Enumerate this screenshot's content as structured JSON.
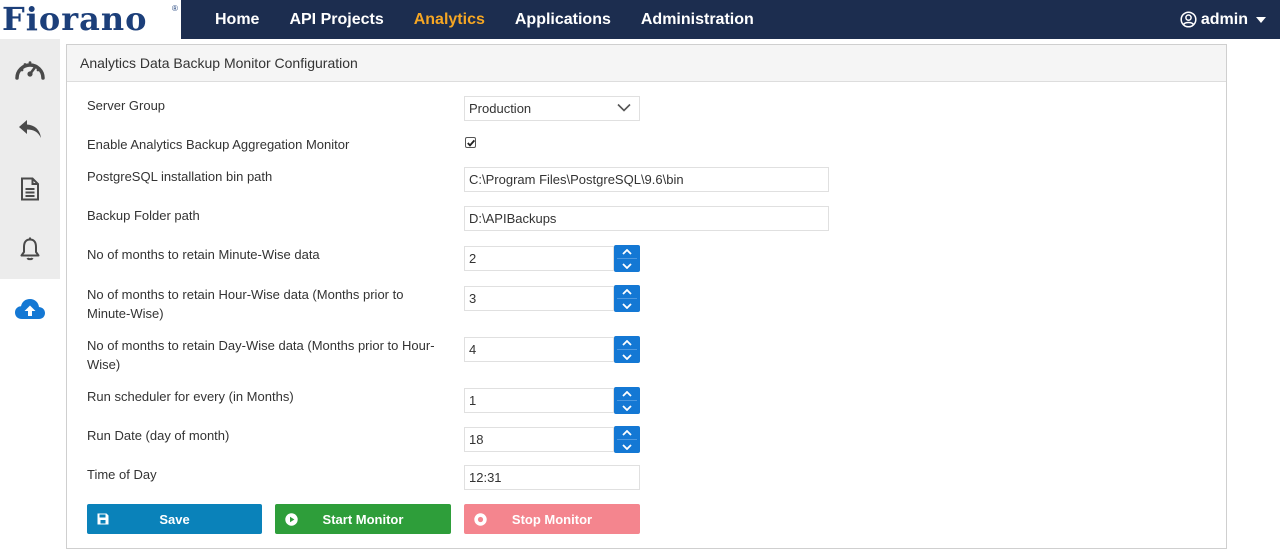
{
  "brand": {
    "logo_text": "Fiorano",
    "reg_mark": "®"
  },
  "nav": {
    "items": [
      {
        "label": "Home"
      },
      {
        "label": "API Projects"
      },
      {
        "label": "Analytics",
        "active": true
      },
      {
        "label": "Applications"
      },
      {
        "label": "Administration"
      }
    ],
    "user": {
      "icon": "user-circle-icon",
      "label": "admin"
    }
  },
  "sidebar": {
    "items": [
      {
        "icon": "dashboard-gauge-icon"
      },
      {
        "icon": "reply-arrow-icon"
      },
      {
        "icon": "document-icon"
      },
      {
        "icon": "bell-icon"
      },
      {
        "icon": "cloud-upload-icon",
        "active": true
      }
    ]
  },
  "panel": {
    "title": "Analytics Data Backup Monitor Configuration",
    "fields": {
      "server_group": {
        "label": "Server Group",
        "value": "Production"
      },
      "enable_monitor": {
        "label": "Enable Analytics Backup Aggregation Monitor",
        "checked": true
      },
      "pg_bin_path": {
        "label": "PostgreSQL installation bin path",
        "value": "C:\\Program Files\\PostgreSQL\\9.6\\bin"
      },
      "backup_folder": {
        "label": "Backup Folder path",
        "value": "D:\\APIBackups"
      },
      "minute_months": {
        "label": "No of months to retain Minute-Wise data",
        "value": "2"
      },
      "hour_months": {
        "label": "No of months to retain Hour-Wise data (Months prior to Minute-Wise)",
        "value": "3"
      },
      "day_months": {
        "label": "No of months to retain Day-Wise data (Months prior to Hour-Wise)",
        "value": "4"
      },
      "scheduler_months": {
        "label": "Run scheduler for every (in Months)",
        "value": "1"
      },
      "run_date": {
        "label": "Run Date (day of month)",
        "value": "18"
      },
      "time_of_day": {
        "label": "Time of Day",
        "value": "12:31"
      }
    },
    "buttons": {
      "save": "Save",
      "start": "Start Monitor",
      "stop": "Stop Monitor"
    }
  },
  "colors": {
    "topbar": "#1c2d4f",
    "nav_active": "#f5a623",
    "spinner": "#1478d4",
    "save": "#0a82ba",
    "start": "#2e9e3a",
    "stop": "#f4858e"
  }
}
